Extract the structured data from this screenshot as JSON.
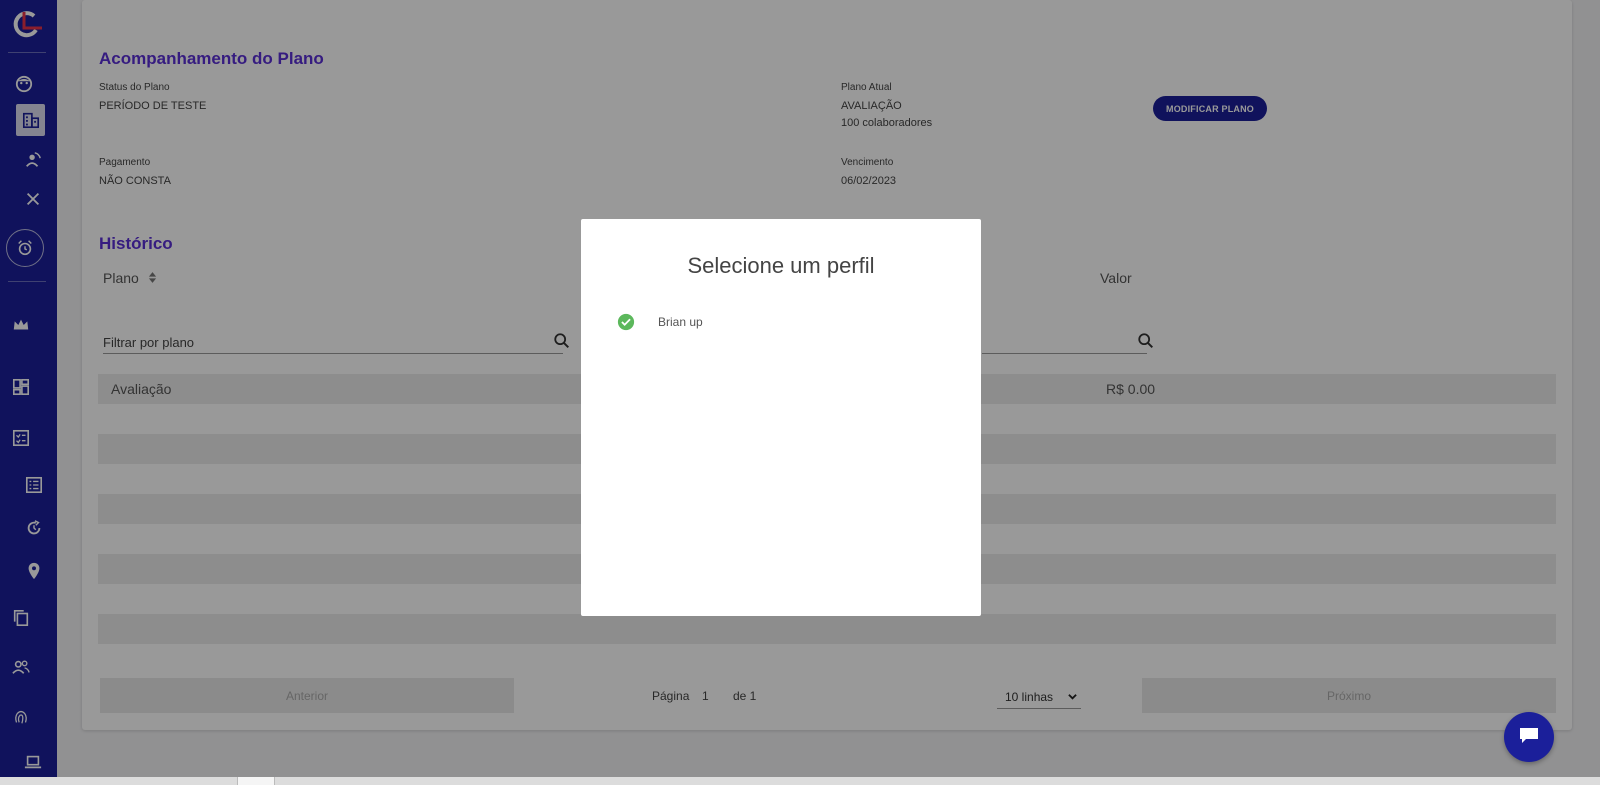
{
  "plan_section": {
    "title": "Acompanhamento do Plano",
    "status_label": "Status do Plano",
    "status_value": "PERÍODO DE TESTE",
    "current_plan_label": "Plano Atual",
    "current_plan_value": "AVALIAÇÃO",
    "current_plan_seats": "100 colaboradores",
    "modify_button": "MODIFICAR PLANO",
    "payment_label": "Pagamento",
    "payment_value": "NÃO CONSTA",
    "due_label": "Vencimento",
    "due_value": "06/02/2023"
  },
  "history_section": {
    "title": "Histórico",
    "col_plan": "Plano",
    "col_value": "Valor",
    "filter_placeholder": "Filtrar por plano",
    "rows": [
      {
        "plan": "Avaliação",
        "value": "R$ 0.00"
      }
    ]
  },
  "pagination": {
    "prev": "Anterior",
    "page_label": "Página",
    "page_number": "1",
    "of_label": "de 1",
    "rows_option": "10 linhas",
    "next": "Próximo"
  },
  "modal": {
    "title": "Selecione um perfil",
    "profiles": [
      {
        "name": "Brian up"
      }
    ]
  },
  "colors": {
    "sidebar": "#1b1f9a",
    "accent_title": "#5b2fd6",
    "check_green": "#5cb85c"
  }
}
